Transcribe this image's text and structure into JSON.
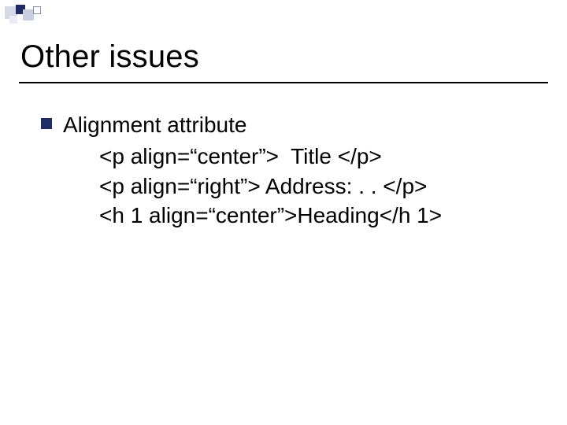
{
  "title": "Other issues",
  "bullet": {
    "label": "Alignment attribute",
    "lines": [
      "<p align=“center”>  Title </p>",
      "<p align=“right”> Address: . . </p>",
      "<h 1 align=“center”>Heading</h 1>"
    ]
  }
}
